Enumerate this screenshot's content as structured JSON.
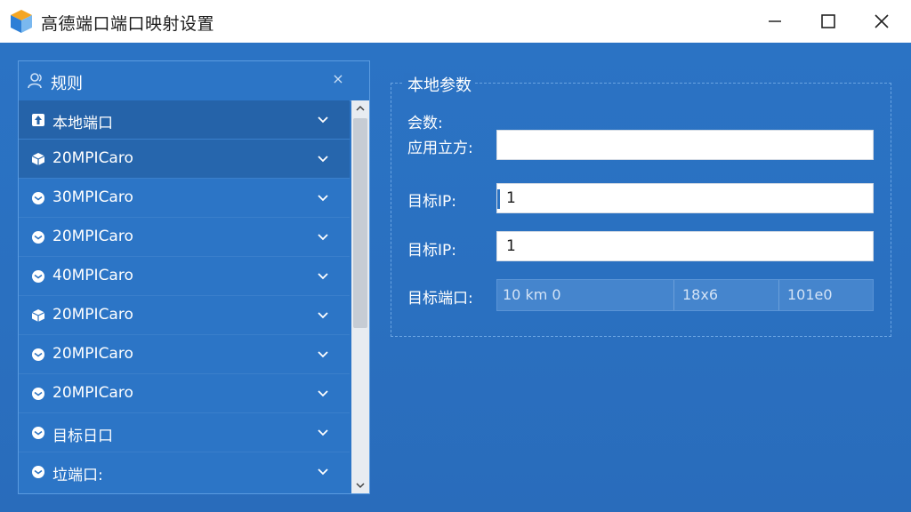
{
  "window": {
    "title": "高德端口端口映射设置",
    "icons": [
      "app-cube-icon",
      "minimize-icon",
      "maximize-icon",
      "close-icon"
    ]
  },
  "rules": {
    "header": "规则",
    "close_symbol": "×",
    "items": [
      {
        "label": "本地端口",
        "icon": "upload-icon"
      },
      {
        "label": "20MPICaro",
        "icon": "box-icon"
      },
      {
        "label": "30MPICaro",
        "icon": "box-icon"
      },
      {
        "label": "20MPICaro",
        "icon": "box-icon"
      },
      {
        "label": "40MPICaro",
        "icon": "box-icon"
      },
      {
        "label": "20MPICaro",
        "icon": "box-icon"
      },
      {
        "label": "20MPICaro",
        "icon": "box-icon"
      },
      {
        "label": "20MPICaro",
        "icon": "box-icon"
      },
      {
        "label": "目标日口",
        "icon": "box-icon"
      },
      {
        "label": "垃端口:",
        "icon": "box-icon"
      }
    ]
  },
  "params": {
    "group_title": "本地参数",
    "label_top": "会数:",
    "label_source": "应用立方:",
    "source_value": "",
    "target_ip_label_1": "目标IP:",
    "target_ip_value_1": "1",
    "target_ip_label_2": "目标IP:",
    "target_ip_value_2": "1",
    "target_port_label": "目标端口:",
    "ports": [
      "10 km 0",
      "18x6",
      "101e0"
    ]
  },
  "colors": {
    "accent": "#2a72c2",
    "panel_border": "#5b9be0",
    "selected_row": "#2563a9"
  }
}
